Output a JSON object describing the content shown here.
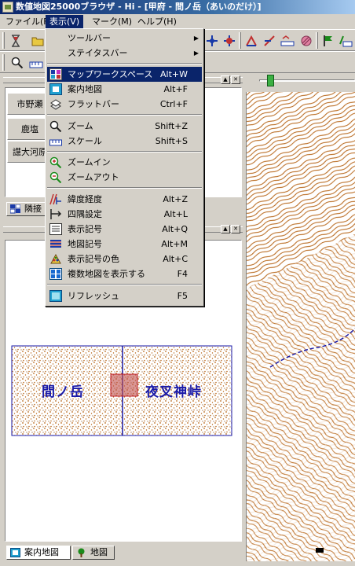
{
  "window": {
    "title": "数値地図25000ブラウザ - Hi - [甲府 - 間ノ岳（あいのだけ）]"
  },
  "menubar": {
    "items": [
      {
        "label": "ファイル(F)",
        "active": false
      },
      {
        "label": "表示(V)",
        "active": true
      },
      {
        "label": "マーク(M)",
        "active": false
      },
      {
        "label": "ヘルプ(H)",
        "active": false
      }
    ]
  },
  "view_menu": {
    "items": [
      {
        "label": "ツールバー",
        "shortcut": "",
        "submenu": true,
        "icon": ""
      },
      {
        "label": "ステイタスバー",
        "shortcut": "",
        "submenu": true,
        "icon": ""
      },
      {
        "label": "マップワークスペース",
        "shortcut": "Alt+W",
        "highlighted": true,
        "icon": "workspace-icon"
      },
      {
        "label": "案内地図",
        "shortcut": "Alt+F",
        "icon": "guide-map-icon"
      },
      {
        "label": "フラットバー",
        "shortcut": "Ctrl+F",
        "icon": "flatbar-icon"
      },
      {
        "label": "ズーム",
        "shortcut": "Shift+Z",
        "icon": "magnifier-icon"
      },
      {
        "label": "スケール",
        "shortcut": "Shift+S",
        "icon": "scale-icon"
      },
      {
        "label": "ズームイン",
        "shortcut": "",
        "icon": "zoom-in-icon"
      },
      {
        "label": "ズームアウト",
        "shortcut": "",
        "icon": "zoom-out-icon"
      },
      {
        "label": "緯度経度",
        "shortcut": "Alt+Z",
        "icon": "latlon-icon"
      },
      {
        "label": "四隅設定",
        "shortcut": "Alt+L",
        "icon": "corners-icon"
      },
      {
        "label": "表示記号",
        "shortcut": "Alt+Q",
        "icon": "display-symbol-icon"
      },
      {
        "label": "地図記号",
        "shortcut": "Alt+M",
        "icon": "map-symbol-icon"
      },
      {
        "label": "表示記号の色",
        "shortcut": "Alt+C",
        "icon": "palette-icon"
      },
      {
        "label": "複数地図を表示する",
        "shortcut": "F4",
        "icon": "multi-map-icon"
      },
      {
        "label": "リフレッシュ",
        "shortcut": "F5",
        "icon": "refresh-icon"
      }
    ]
  },
  "adjacent_panel": {
    "cells": [
      "市野瀬",
      "鹿塩",
      "譿大河原"
    ],
    "tab_label": "隣接"
  },
  "guide_map": {
    "left_sheet": "間ノ岳",
    "right_sheet": "夜叉神峠"
  },
  "bottom_tabs": [
    {
      "label": "案内地図",
      "icon": "guide-map-icon"
    },
    {
      "label": "地図",
      "icon": "tree-icon"
    }
  ],
  "colors": {
    "title_bar": "#0a246a",
    "highlight": "#0a246a",
    "contour": "#b8681c",
    "sheet_border": "#1a1aa8",
    "selection": "#c0504d"
  }
}
